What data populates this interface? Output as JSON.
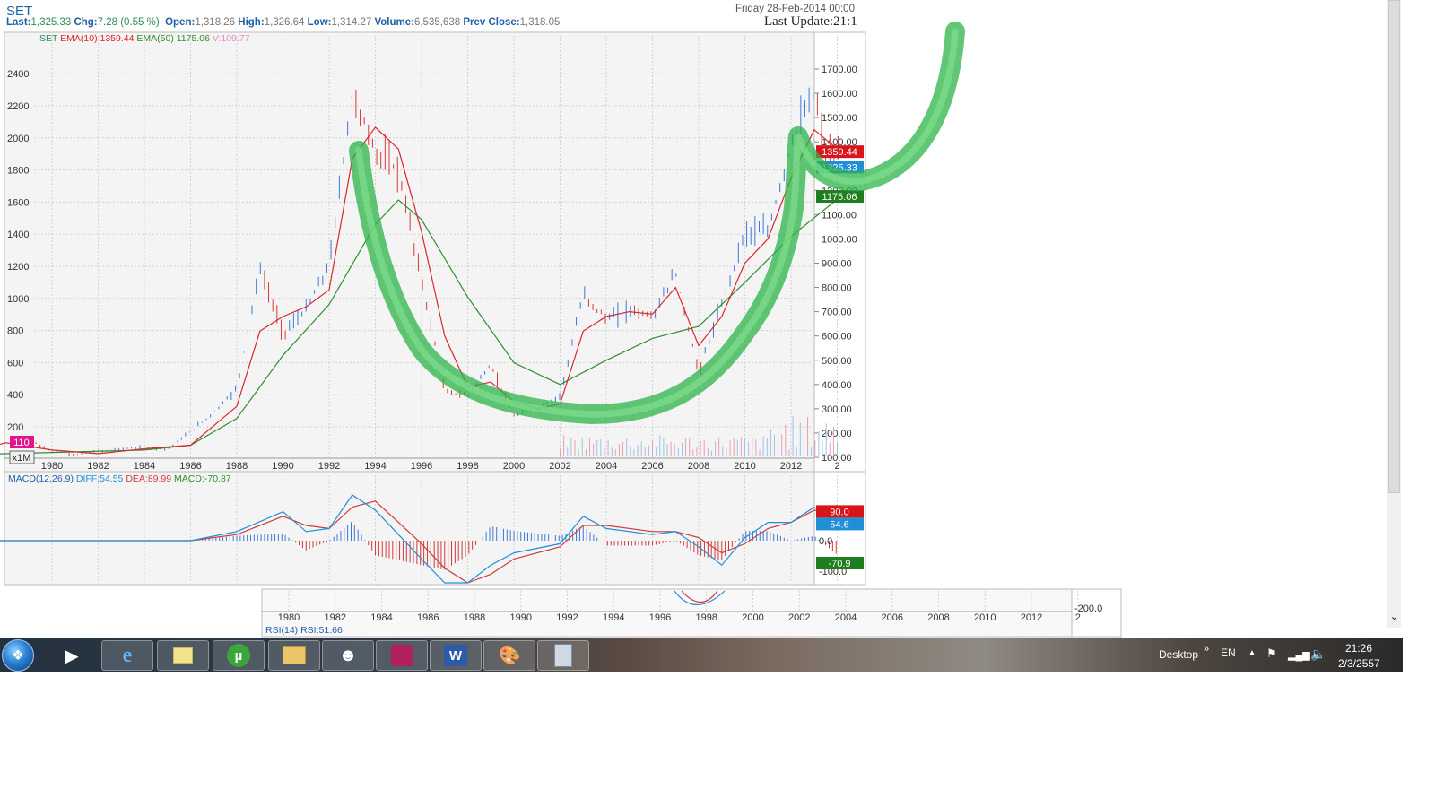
{
  "header": {
    "symbol": "SET",
    "last_label": "Last:",
    "last_value": "1,325.33",
    "chg_label": "Chg:",
    "chg_value": "7.28 (0.55 %)",
    "open_label": "Open:",
    "open_value": "1,318.26",
    "high_label": "High:",
    "high_value": "1,326.64",
    "low_label": "Low:",
    "low_value": "1,314.27",
    "volume_label": "Volume:",
    "volume_value": "6,535,638",
    "prev_label": "Prev Close:",
    "prev_value": "1,318.05",
    "date": "Friday 28-Feb-2014 00:00",
    "last_update": "Last Update:21:1"
  },
  "legend": {
    "symbol": "SET",
    "ema10": "EMA(10) 1359.44",
    "ema50": "EMA(50) 1175.06",
    "volume": "V:109.77"
  },
  "badges": {
    "ema10": "1359.44",
    "last": "1325.33",
    "ema50": "1175.06",
    "volume": "110",
    "zoom": "x1M",
    "macd_dea": "90.0",
    "macd_diff": "54.6",
    "macd_hist": "-70.9"
  },
  "macd_legend": {
    "name": "MACD(12,26,9)",
    "diff": "DIFF:54.55",
    "dea": "DEA:89.99",
    "macd": "MACD:-70.87"
  },
  "rsi_legend": "RSI(14) RSI:51.66",
  "colors": {
    "ema10": "#d9262b",
    "ema50": "#2f8f2f",
    "candle_up": "#3a78d6",
    "candle_down": "#d23a3a",
    "volume_badge": "#e0168a",
    "highlight_stroke": "#2db34a"
  },
  "chart_data": [
    {
      "type": "line",
      "title": "SET",
      "x_ticks": [
        "1980",
        "1982",
        "1984",
        "1986",
        "1988",
        "1990",
        "1992",
        "1994",
        "1996",
        "1998",
        "2000",
        "2002",
        "2004",
        "2006",
        "2008",
        "2010",
        "2012",
        "2"
      ],
      "left_axis_ticks": [
        "200",
        "400",
        "600",
        "800",
        "1000",
        "1200",
        "1400",
        "1600",
        "1800",
        "2000",
        "2200",
        "2400"
      ],
      "right_axis_ticks": [
        "100.00",
        "200.00",
        "300.00",
        "400.00",
        "500.00",
        "600.00",
        "700.00",
        "800.00",
        "900.00",
        "1000.00",
        "1100.00",
        "1200.00",
        "1300.00",
        "1400.00",
        "1500.00",
        "1600.00",
        "1700.00"
      ],
      "right_ylim": [
        100,
        1750
      ],
      "series": [
        {
          "name": "SET",
          "x": [
            1976,
            1977,
            1978,
            1979,
            1980,
            1981,
            1982,
            1983,
            1984,
            1985,
            1986,
            1987,
            1988,
            1989,
            1990,
            1991,
            1992,
            1993,
            1994,
            1995,
            1996,
            1997,
            1998,
            1999,
            2000,
            2001,
            2002,
            2003,
            2004,
            2005,
            2006,
            2007,
            2008,
            2009,
            2010,
            2011,
            2012,
            2013,
            2013.5,
            2014.15
          ],
          "values": [
            110,
            150,
            220,
            170,
            125,
            110,
            125,
            135,
            140,
            135,
            205,
            285,
            385,
            880,
            610,
            710,
            890,
            1600,
            1360,
            1280,
            830,
            370,
            355,
            480,
            270,
            300,
            355,
            770,
            670,
            710,
            680,
            860,
            450,
            730,
            1030,
            1030,
            1390,
            1600,
            1350,
            1325
          ]
        },
        {
          "name": "EMA(10)",
          "x": [
            1976,
            1978,
            1980,
            1982,
            1984,
            1986,
            1988,
            1989,
            1990,
            1991,
            1992,
            1993,
            1994,
            1995,
            1996,
            1997,
            1998,
            1999,
            2000,
            2001,
            2002,
            2003,
            2004,
            2005,
            2006,
            2007,
            2008,
            2009,
            2010,
            2011,
            2012,
            2013,
            2014.15
          ],
          "values": [
            110,
            160,
            130,
            115,
            135,
            150,
            310,
            620,
            680,
            720,
            790,
            1330,
            1460,
            1370,
            1030,
            600,
            390,
            410,
            330,
            300,
            320,
            620,
            680,
            700,
            690,
            800,
            560,
            680,
            900,
            1000,
            1250,
            1450,
            1359
          ]
        },
        {
          "name": "EMA(50)",
          "x": [
            1976,
            1980,
            1984,
            1986,
            1988,
            1990,
            1992,
            1994,
            1995,
            1996,
            1998,
            2000,
            2002,
            2004,
            2006,
            2008,
            2010,
            2012,
            2014.15
          ],
          "values": [
            110,
            120,
            130,
            150,
            260,
            520,
            730,
            1060,
            1160,
            1080,
            760,
            490,
            400,
            500,
            590,
            640,
            820,
            1010,
            1175
          ]
        }
      ]
    },
    {
      "type": "line",
      "title": "MACD(12,26,9)",
      "x_ticks": [
        "1980",
        "1982",
        "1984",
        "1986",
        "1988",
        "1990",
        "1992",
        "1994",
        "1996",
        "1998",
        "2000",
        "2002",
        "2004",
        "2006",
        "2008",
        "2010",
        "2012",
        "2"
      ],
      "y_ticks": [
        "-200.0",
        "-100.0",
        "0.0"
      ],
      "ylim": [
        -200,
        200
      ],
      "series": [
        {
          "name": "DIFF",
          "x": [
            1976,
            1980,
            1984,
            1986,
            1988,
            1990,
            1991,
            1992,
            1993,
            1994,
            1995,
            1996,
            1997,
            1998,
            1999,
            2000,
            2002,
            2003,
            2004,
            2006,
            2007,
            2008,
            2009,
            2010,
            2011,
            2012,
            2013,
            2014.15
          ],
          "values": [
            0,
            0,
            0,
            0,
            30,
            95,
            30,
            40,
            150,
            100,
            20,
            -60,
            -150,
            -170,
            -80,
            -40,
            -10,
            80,
            40,
            20,
            30,
            -20,
            -80,
            10,
            60,
            60,
            110,
            55
          ]
        },
        {
          "name": "DEA",
          "x": [
            1976,
            1980,
            1984,
            1986,
            1988,
            1990,
            1991,
            1992,
            1993,
            1994,
            1995,
            1996,
            1997,
            1998,
            1999,
            2000,
            2002,
            2003,
            2004,
            2006,
            2007,
            2008,
            2009,
            2010,
            2011,
            2012,
            2013,
            2014.15
          ],
          "values": [
            0,
            0,
            0,
            0,
            20,
            80,
            50,
            40,
            110,
            130,
            60,
            -10,
            -90,
            -140,
            -110,
            -60,
            -20,
            50,
            50,
            30,
            30,
            10,
            -40,
            -10,
            40,
            60,
            100,
            90
          ]
        }
      ]
    }
  ],
  "taskbar": {
    "desktop_label": "Desktop",
    "lang": "EN",
    "time": "21:26",
    "date": "2/3/2557",
    "expand": "»"
  }
}
